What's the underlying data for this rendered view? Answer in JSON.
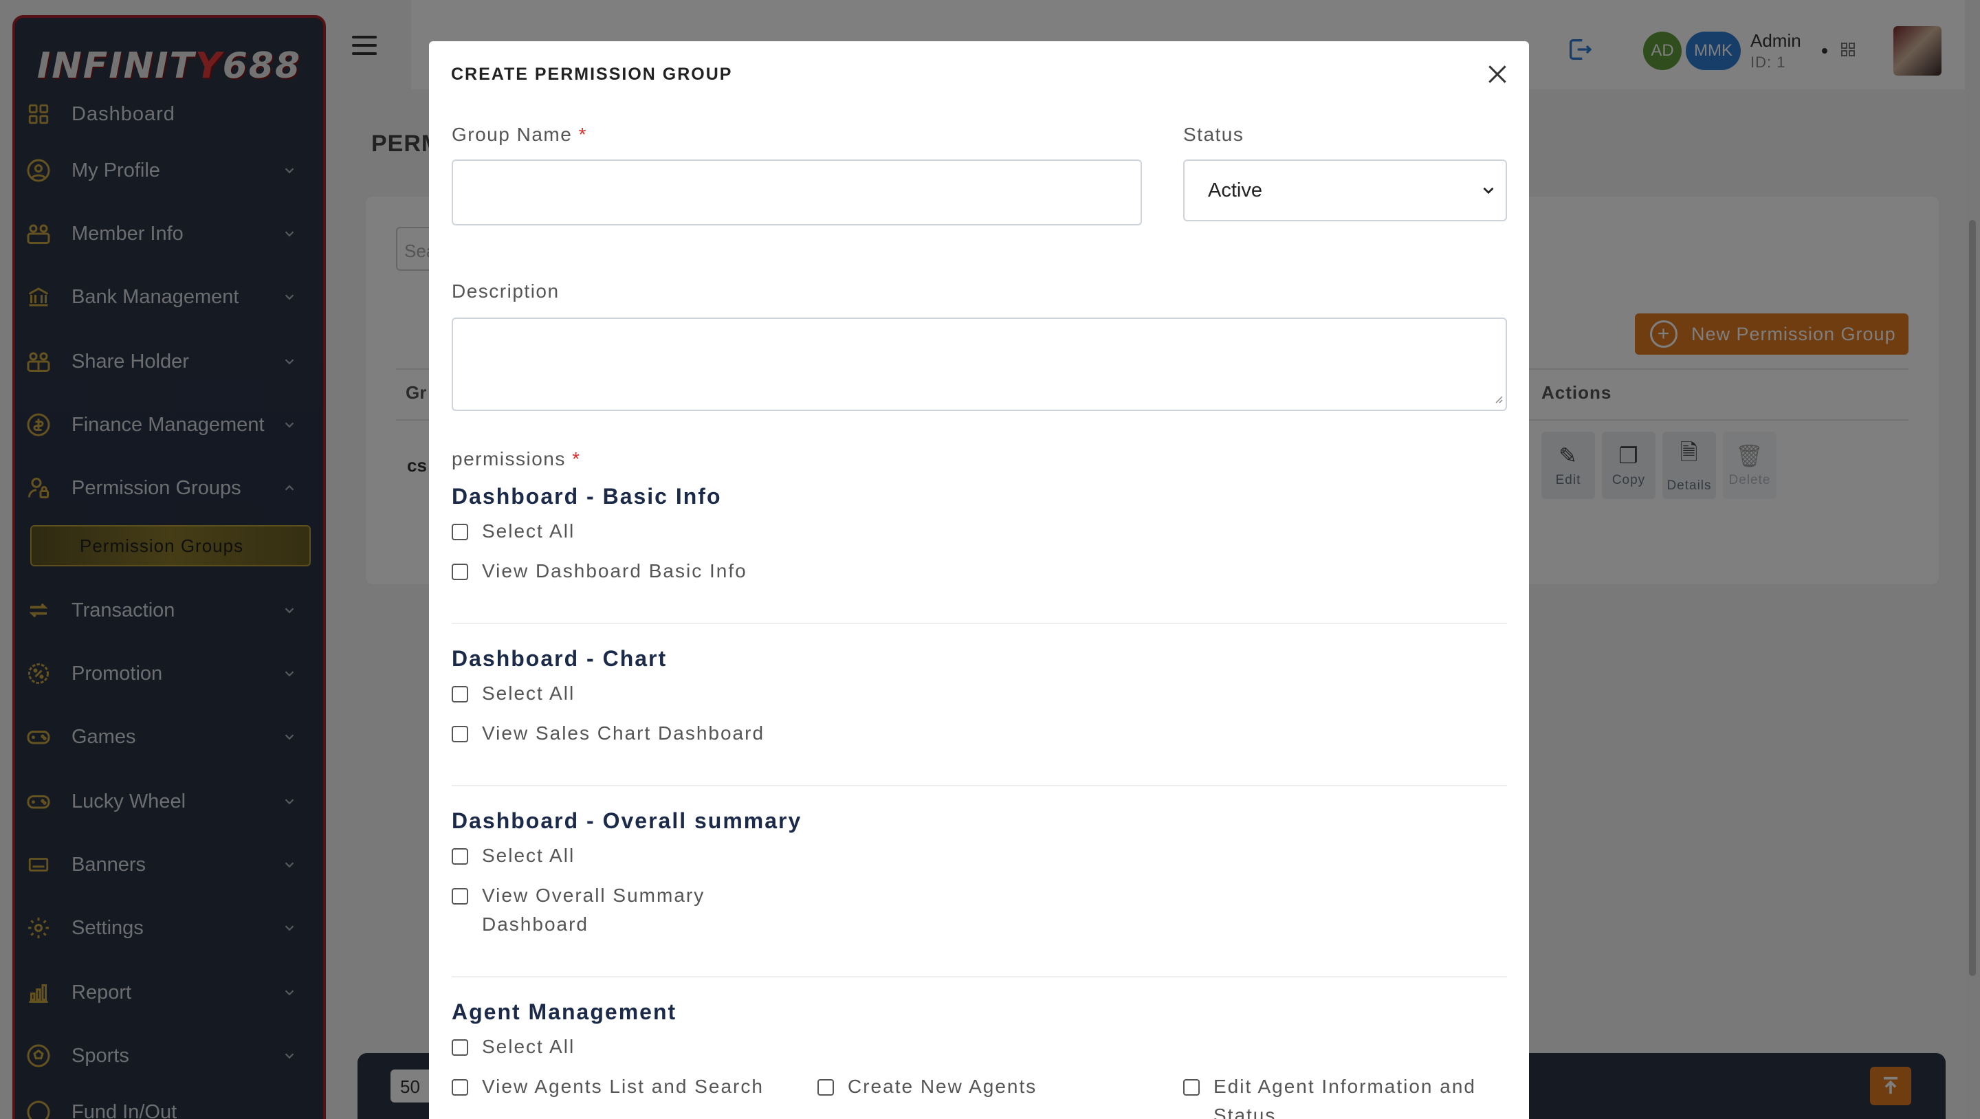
{
  "sidebar": {
    "logo_left": "INFINIT",
    "logo_mid": "Y",
    "logo_right": "688",
    "items": [
      {
        "label": "Dashboard"
      },
      {
        "label": "My Profile"
      },
      {
        "label": "Member Info"
      },
      {
        "label": "Bank Management"
      },
      {
        "label": "Share Holder"
      },
      {
        "label": "Finance Management"
      },
      {
        "label": "Permission Groups"
      },
      {
        "label": "Transaction"
      },
      {
        "label": "Promotion"
      },
      {
        "label": "Games"
      },
      {
        "label": "Lucky Wheel"
      },
      {
        "label": "Banners"
      },
      {
        "label": "Settings"
      },
      {
        "label": "Report"
      },
      {
        "label": "Sports"
      },
      {
        "label": "Fund In/Out"
      }
    ],
    "active_sub": "Permission Groups"
  },
  "header": {
    "avatar_ad": "AD",
    "avatar_mmk": "MMK",
    "admin_name": "Admin",
    "admin_id": "ID: 1"
  },
  "background": {
    "page_title": "PERM",
    "search_placeholder": "Sea",
    "new_button": "New Permission Group",
    "col_group": "Gr",
    "col_actions": "Actions",
    "row_group": "cs",
    "actions": [
      "Edit",
      "Copy",
      "Details",
      "Delete"
    ],
    "page_size": "50"
  },
  "modal": {
    "title": "CREATE PERMISSION GROUP",
    "group_name_label": "Group Name",
    "required_mark": "*",
    "group_name_value": "",
    "status_label": "Status",
    "status_value": "Active",
    "description_label": "Description",
    "description_value": "",
    "permissions_label": "permissions",
    "sections": [
      {
        "title": "Dashboard - Basic Info",
        "select_all": "Select All",
        "items": [
          "View Dashboard Basic Info"
        ]
      },
      {
        "title": "Dashboard - Chart",
        "select_all": "Select All",
        "items": [
          "View Sales Chart Dashboard"
        ]
      },
      {
        "title": "Dashboard - Overall summary",
        "select_all": "Select All",
        "items": [
          "View Overall Summary Dashboard"
        ]
      },
      {
        "title": "Agent Management",
        "select_all": "Select All",
        "items": [
          "View Agents List and Search",
          "Create New Agents",
          "Edit Agent Information and Status"
        ]
      }
    ]
  },
  "colors": {
    "accent_orange": "#e07a22",
    "sidebar_bg": "#2c3447",
    "sidebar_border": "#a8222c",
    "active_sub_bg": "#8b7a2c",
    "icon_gold": "#c9a640",
    "section_title": "#1c2a4a",
    "required": "#d9302c",
    "avatar_ad": "#5e9a3a",
    "avatar_mmk": "#2f7dd1"
  }
}
